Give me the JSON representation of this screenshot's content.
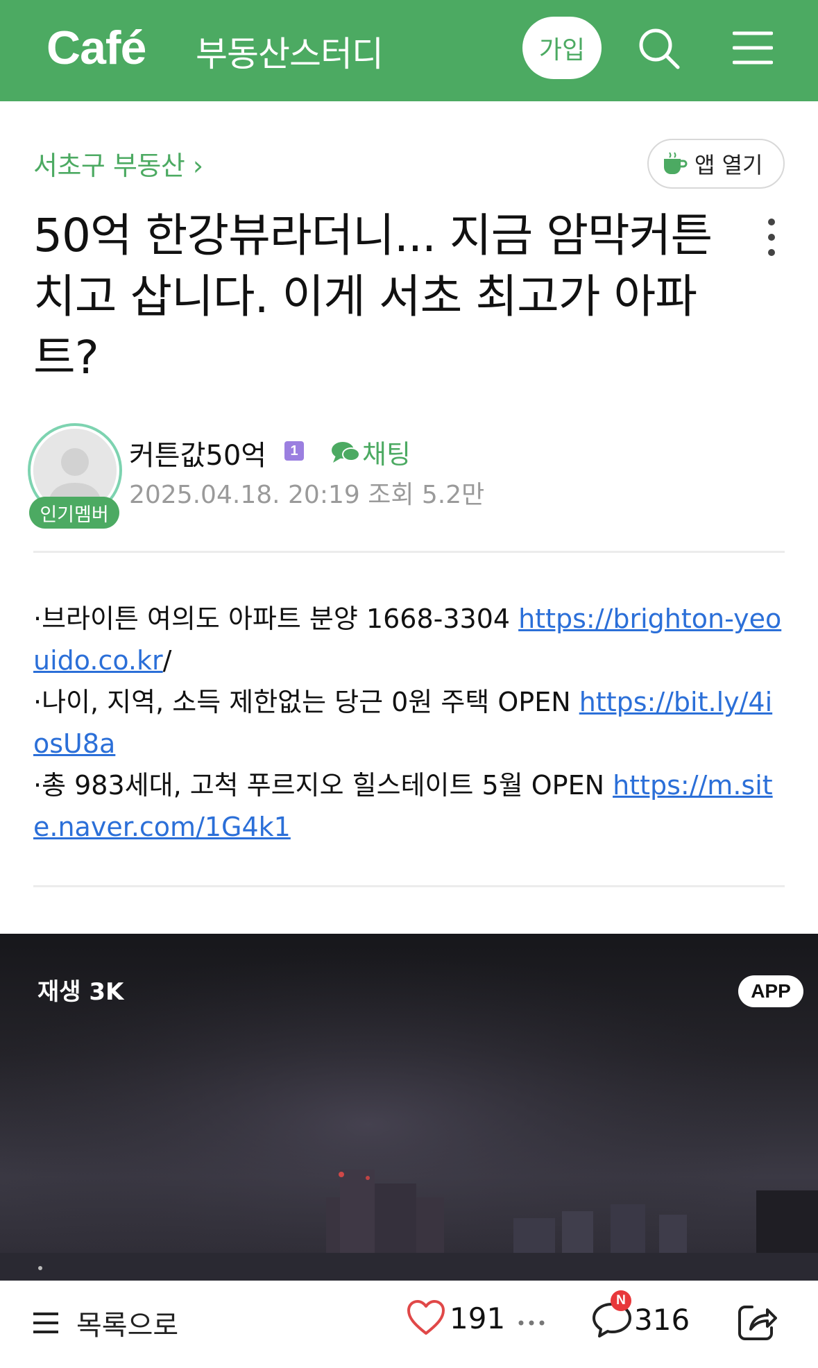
{
  "header": {
    "logo": "Café",
    "cafe_name": "부동산스터디",
    "join_label": "가입",
    "search_icon": "search-icon",
    "menu_icon": "hamburger-menu-icon",
    "bg_color": "#4caa62"
  },
  "category": {
    "label": "서초구 부동산 ›",
    "app_open_label": "앱 열기"
  },
  "post": {
    "title": "50억 한강뷰라더니... 지금 암막커튼 치고 삽니다. 이게 서초 최고가 아파트?",
    "author": {
      "name": "커튼값50억",
      "level": "1",
      "badge": "인기멤버",
      "chat_label": "채팅",
      "meta": "2025.04.18. 20:19  조회 5.2만"
    }
  },
  "ads": [
    {
      "text": "·브라이튼 여의도 아파트 분양 1668-3304 ",
      "link": "https://brighton-yeouido.co.kr",
      "suffix": "/"
    },
    {
      "text": "·나이, 지역, 소득 제한없는 당근 0원 주택 OPEN ",
      "link": "https://bit.ly/4iosU8a",
      "suffix": ""
    },
    {
      "text": "·총 983세대, 고척 푸르지오 힐스테이트 5월 OPEN ",
      "link": "https://m.site.naver.com/1G4k1",
      "suffix": ""
    }
  ],
  "video": {
    "play_count": "재생 3K",
    "app_badge": "APP"
  },
  "bottom": {
    "list_label": "목록으로",
    "like_count": "191",
    "comment_count": "316",
    "new_badge": "N"
  }
}
